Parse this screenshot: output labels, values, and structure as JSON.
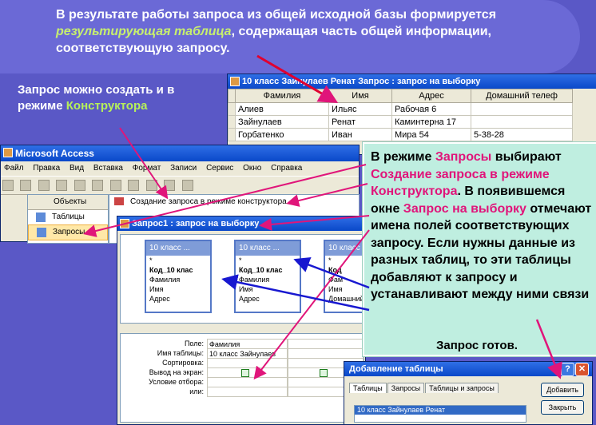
{
  "banner": {
    "line1": "В результате работы запроса из общей исходной базы формируется",
    "highlight": "результирующая таблица",
    "line2": ", содержащая часть общей информации, соответствующую запросу."
  },
  "left_note": {
    "text": "Запрос можно создать и в режиме ",
    "highlight": "Конструктора"
  },
  "query_window": {
    "title": "10 класс Зайнулаев Ренат Запрос : запрос на выборку",
    "columns": [
      "Фамилия",
      "Имя",
      "Адрес",
      "Домашний телеф"
    ],
    "rows": [
      [
        "Алиев",
        "Ильяс",
        "Рабочая 6",
        ""
      ],
      [
        "Зайнулаев",
        "Ренат",
        "Каминтерна 17",
        ""
      ],
      [
        "Горбатенко",
        "Иван",
        "Мира 54",
        "5-38-28"
      ]
    ]
  },
  "access": {
    "title": "Microsoft Access",
    "menu": [
      "Файл",
      "Правка",
      "Вид",
      "Вставка",
      "Формат",
      "Записи",
      "Сервис",
      "Окно",
      "Справка"
    ],
    "objects_header": "Объекты",
    "objects": [
      "Таблицы",
      "Запросы"
    ],
    "list_item": "Создание запроса в режиме конструктора"
  },
  "designer": {
    "title": "Запрос1 : запрос на выборку",
    "tables": [
      {
        "name": "10 класс ...",
        "fields": [
          "*",
          "Код_10 клас",
          "Фамилия",
          "Имя",
          "Адрес"
        ]
      },
      {
        "name": "10 класс ...",
        "fields": [
          "*",
          "Код_10 клас",
          "Фамилия",
          "Имя",
          "Адрес"
        ]
      },
      {
        "name": "10 класс",
        "fields": [
          "*",
          "Код",
          "Фам",
          "Имя",
          "Домашний"
        ]
      }
    ],
    "grid_labels": [
      "Поле:",
      "Имя таблицы:",
      "Сортировка:",
      "Вывод на экран:",
      "Условие отбора:",
      "или:"
    ],
    "grid_field": "Фамилия",
    "grid_table": "10 класс Зайнулаев"
  },
  "callout": {
    "p1": "В режиме ",
    "hl1": "Запросы",
    "p2": " выбирают ",
    "hl2": "Создание запроса в режиме Конструктора",
    "p3": ". В появившемся окне ",
    "hl3": "Запрос на выборку",
    "p4": " отмечают имена полей соответствующих запросу. Если нужны данные из разных таблиц, то эти таблицы добавляют к запросу и устанавливают между ними связи",
    "ready": "Запрос готов."
  },
  "add_table_dialog": {
    "title": "Добавление таблицы",
    "tabs": [
      "Таблицы",
      "Запросы",
      "Таблицы и запросы"
    ],
    "item": "10 класс Зайнулаев Ренат",
    "add_button": "Добавить",
    "close_button": "Закрыть",
    "help_symbol": "?",
    "close_symbol": "✕"
  },
  "colors": {
    "background": "#5a58c6",
    "accent": "#e0157a",
    "green": "#b6f05a",
    "callout_bg": "#bfeee0"
  }
}
